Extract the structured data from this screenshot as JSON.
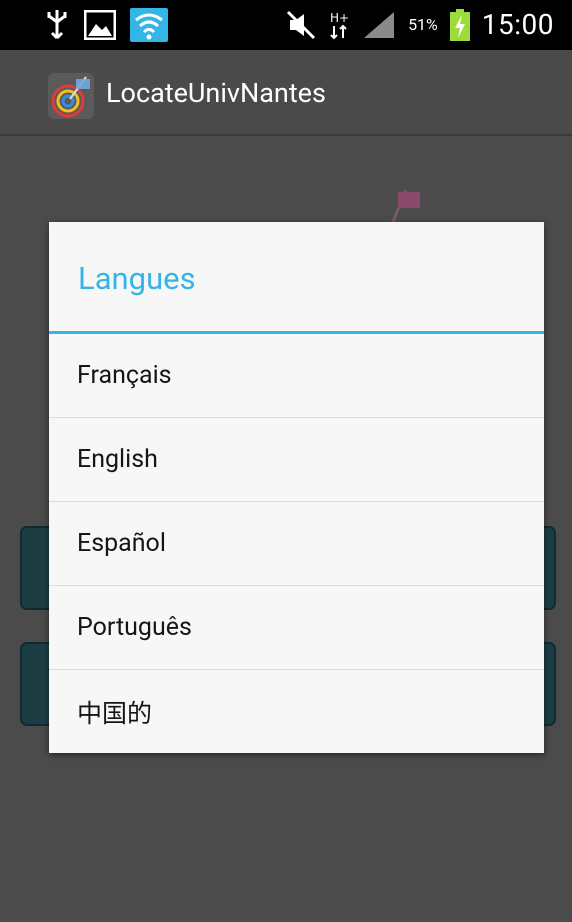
{
  "status_bar": {
    "battery_percent": "51%",
    "time": "15:00",
    "icons": [
      "usb-icon",
      "image-icon",
      "wifi-icon",
      "mute-icon",
      "h-plus-data-icon",
      "signal-icon",
      "battery-charging-icon"
    ]
  },
  "action_bar": {
    "app_title": "LocateUnivNantes",
    "logo_icon": "app-logo-icon"
  },
  "dialog": {
    "title": "Langues",
    "accent_color": "#33b5e5",
    "items": [
      {
        "label": "Français"
      },
      {
        "label": "English"
      },
      {
        "label": "Español"
      },
      {
        "label": "Português"
      },
      {
        "label": "中国的"
      }
    ]
  }
}
